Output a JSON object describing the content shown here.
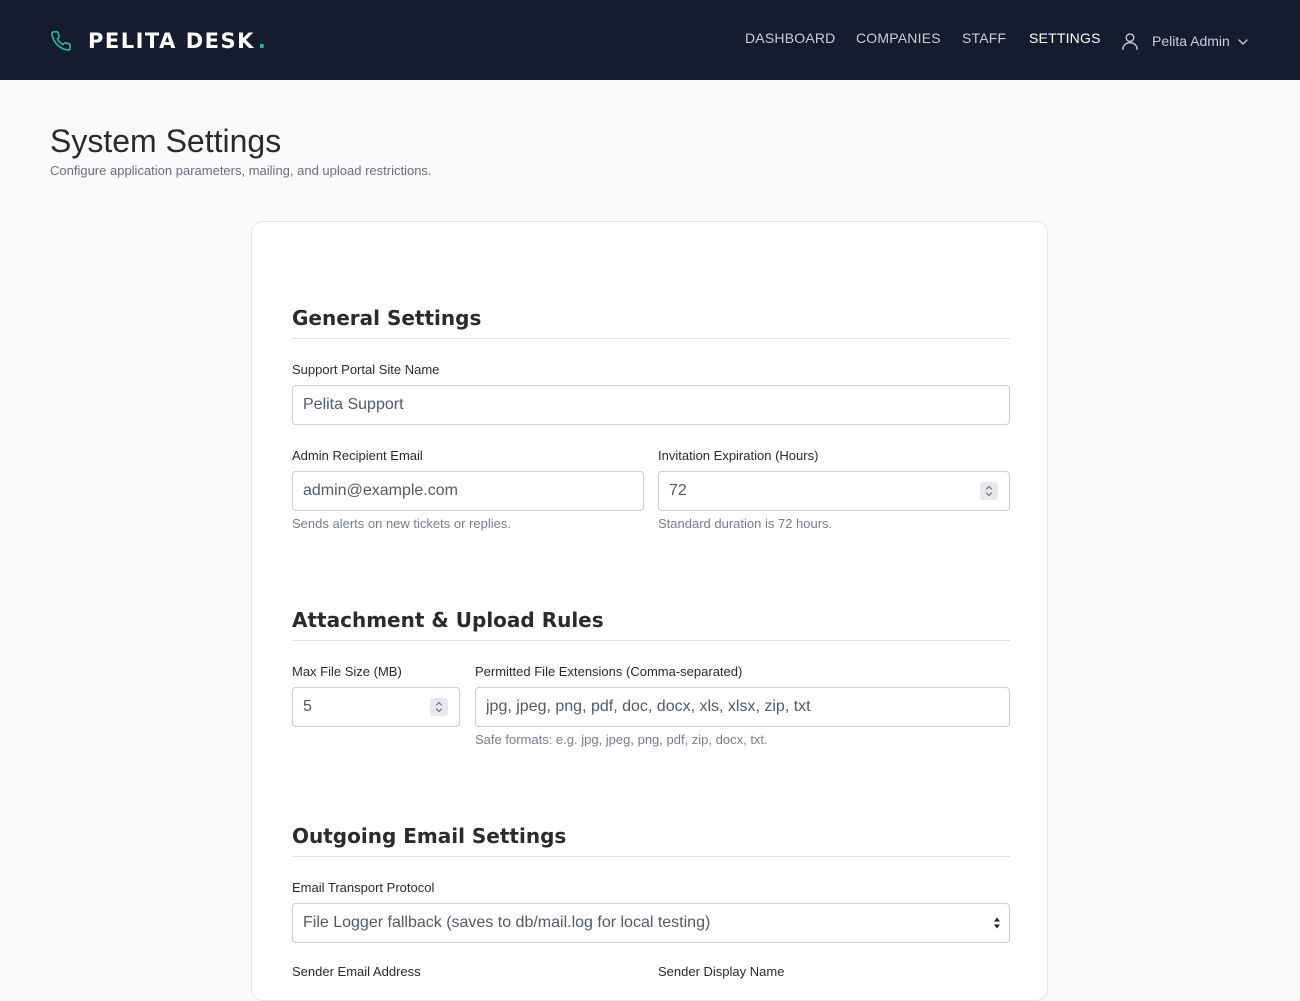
{
  "app": {
    "brand_name": "PELITA DESK",
    "brand_dot": ".",
    "brand_icon": "phone-icon",
    "accent_color": "#2ab3a0",
    "nav_bg": "#141c2e"
  },
  "nav": {
    "items": [
      {
        "label": "DASHBOARD",
        "active": false
      },
      {
        "label": "COMPANIES",
        "active": false
      },
      {
        "label": "STAFF",
        "active": false
      },
      {
        "label": "SETTINGS",
        "active": true
      }
    ],
    "user": {
      "name": "Pelita Admin",
      "icon": "user-icon",
      "dropdown_icon": "chevron-down-icon"
    }
  },
  "page": {
    "title": "System Settings",
    "subtitle": "Configure application parameters, mailing, and upload restrictions."
  },
  "general": {
    "title": "General Settings",
    "site_name": {
      "label": "Support Portal Site Name",
      "value": "Pelita Support"
    },
    "admin_email": {
      "label": "Admin Recipient Email",
      "value": "admin@example.com",
      "hint": "Sends alerts on new tickets or replies."
    },
    "invite_expiry": {
      "label": "Invitation Expiration (Hours)",
      "value": "72",
      "hint": "Standard duration is 72 hours."
    }
  },
  "uploads": {
    "title": "Attachment & Upload Rules",
    "max_size": {
      "label": "Max File Size (MB)",
      "value": "5"
    },
    "extensions": {
      "label": "Permitted File Extensions (Comma-separated)",
      "value": "jpg, jpeg, png, pdf, doc, docx, xls, xlsx, zip, txt",
      "hint": "Safe formats: e.g. jpg, jpeg, png, pdf, zip, docx, txt."
    }
  },
  "email": {
    "title": "Outgoing Email Settings",
    "transport": {
      "label": "Email Transport Protocol",
      "value": "File Logger fallback (saves to db/mail.log for local testing)"
    },
    "sender_email": {
      "label": "Sender Email Address"
    },
    "sender_name": {
      "label": "Sender Display Name"
    }
  }
}
